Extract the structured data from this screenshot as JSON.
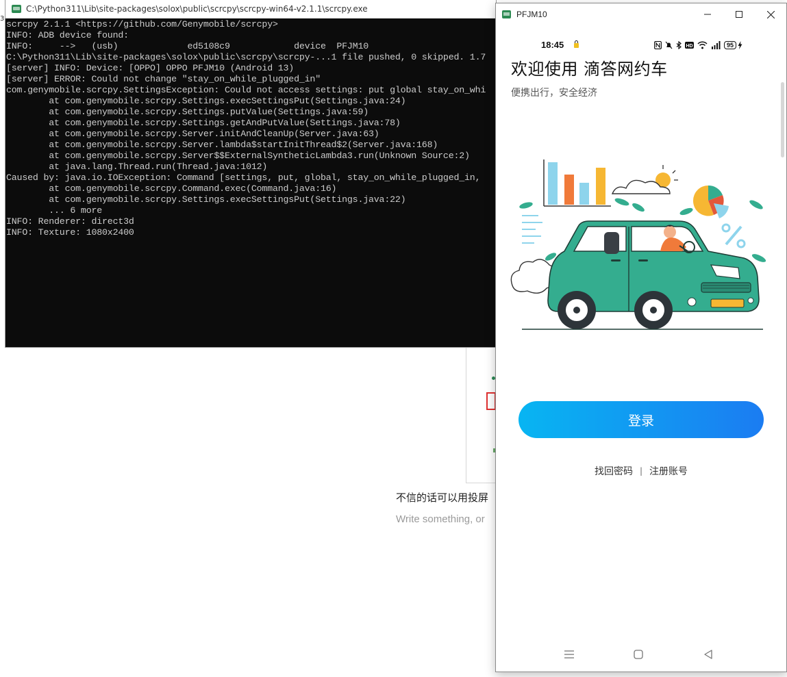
{
  "background": {
    "number_fragment": "3",
    "chinese_text": "不信的话可以用投屏",
    "placeholder_text": "Write something, or"
  },
  "console": {
    "title": "C:\\Python311\\Lib\\site-packages\\solox\\public\\scrcpy\\scrcpy-win64-v2.1.1\\scrcpy.exe",
    "lines": [
      "scrcpy 2.1.1 <https://github.com/Genymobile/scrcpy>",
      "INFO: ADB device found:",
      "INFO:     -->   (usb)             ed5108c9            device  PFJM10",
      "C:\\Python311\\Lib\\site-packages\\solox\\public\\scrcpy\\scrcpy-...1 file pushed, 0 skipped. 1.7",
      "[server] INFO: Device: [OPPO] OPPO PFJM10 (Android 13)",
      "[server] ERROR: Could not change \"stay_on_while_plugged_in\"",
      "com.genymobile.scrcpy.SettingsException: Could not access settings: put global stay_on_whi",
      "        at com.genymobile.scrcpy.Settings.execSettingsPut(Settings.java:24)",
      "        at com.genymobile.scrcpy.Settings.putValue(Settings.java:59)",
      "        at com.genymobile.scrcpy.Settings.getAndPutValue(Settings.java:78)",
      "        at com.genymobile.scrcpy.Server.initAndCleanUp(Server.java:63)",
      "        at com.genymobile.scrcpy.Server.lambda$startInitThread$2(Server.java:168)",
      "        at com.genymobile.scrcpy.Server$$ExternalSyntheticLambda3.run(Unknown Source:2)",
      "        at java.lang.Thread.run(Thread.java:1012)",
      "Caused by: java.io.IOException: Command [settings, put, global, stay_on_while_plugged_in,",
      "        at com.genymobile.scrcpy.Command.exec(Command.java:16)",
      "        at com.genymobile.scrcpy.Settings.execSettingsPut(Settings.java:22)",
      "        ... 6 more",
      "INFO: Renderer: direct3d",
      "INFO: Texture: 1080x2400"
    ]
  },
  "phone_window": {
    "title": "PFJM10",
    "status": {
      "time": "18:45",
      "battery": "95",
      "icons": [
        "nfc-icon",
        "mute-icon",
        "bluetooth-icon",
        "hd-icon",
        "wifi-icon",
        "signal-icon",
        "battery-icon",
        "charging-icon"
      ]
    },
    "welcome_title": "欢迎使用 滴答网约车",
    "welcome_subtitle": "便携出行，安全经济",
    "login_label": "登录",
    "forgot_password": "找回密码",
    "link_separator": "|",
    "register": "注册账号"
  },
  "colors": {
    "console_bg": "#0c0c0c",
    "console_text": "#cccccc",
    "button_gradient_start": "#08b5f2",
    "button_gradient_end": "#1b7cf2",
    "car_green": "#34ad8f"
  }
}
